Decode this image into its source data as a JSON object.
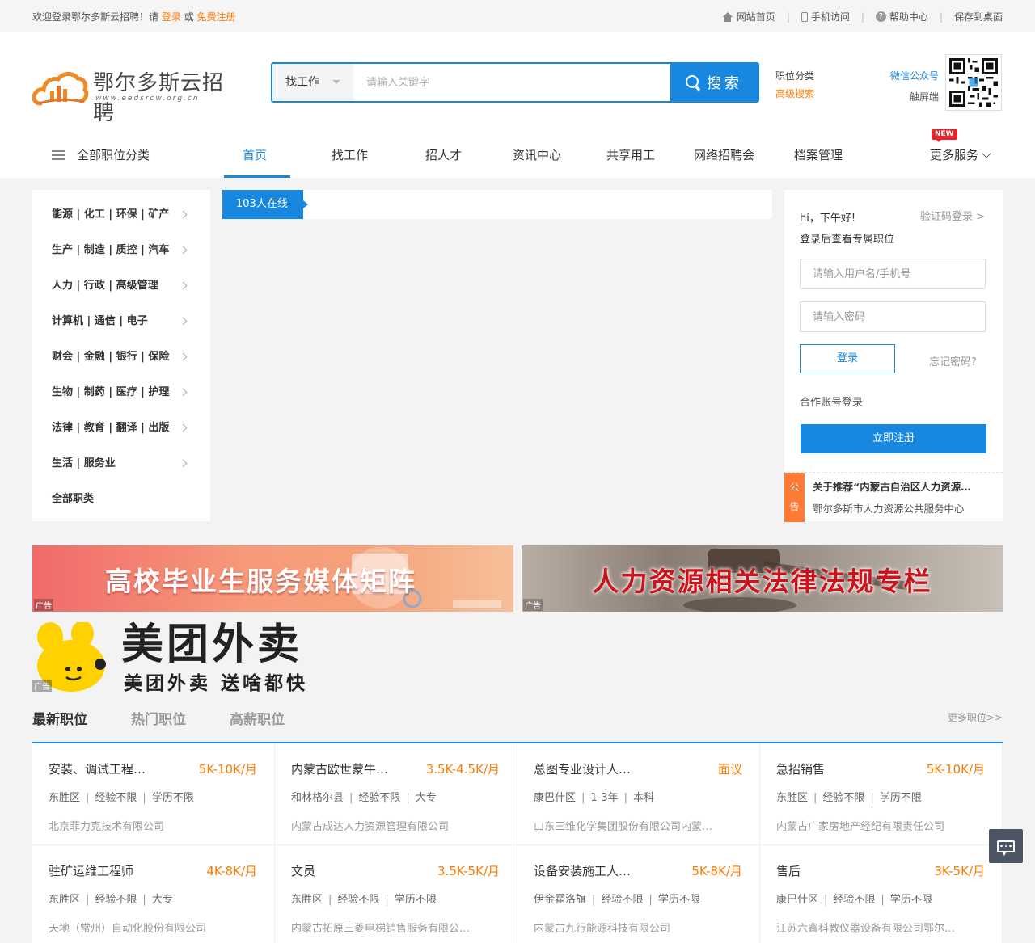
{
  "topbar": {
    "welcome": "欢迎登录鄂尔多斯云招聘！请",
    "login": "登录",
    "or": "或",
    "register": "免费注册",
    "links": [
      {
        "label": "网站首页",
        "icon": "home-icon"
      },
      {
        "label": "手机访问",
        "icon": "phone-icon"
      },
      {
        "label": "帮助中心",
        "icon": "help-icon"
      },
      {
        "label": "保存到桌面",
        "icon": ""
      }
    ],
    "separator": "|"
  },
  "header": {
    "logo_title": "鄂尔多斯云招聘",
    "logo_url": "www.eedsrcw.org.cn",
    "search_type": "找工作",
    "search_placeholder": "请输入关键字",
    "search_button": "搜索",
    "link_category": "职位分类",
    "link_advanced": "高级搜索",
    "wechat": "微信公众号",
    "touch": "触屏端"
  },
  "nav": {
    "all_categories": "全部职位分类",
    "items": [
      "首页",
      "找工作",
      "招人才",
      "资讯中心",
      "共享用工",
      "网络招聘会",
      "档案管理"
    ],
    "more": "更多服务",
    "new_badge": "NEW"
  },
  "categories": [
    "能源 | 化工 | 环保 | 矿产",
    "生产 | 制造 | 质控 | 汽车",
    "人力 | 行政 | 高级管理",
    "计算机 | 通信 | 电子",
    "财会 | 金融 | 银行 | 保险",
    "生物 | 制药 | 医疗 | 护理",
    "法律 | 教育 | 翻译 | 出版",
    "生活 | 服务业",
    "全部职类"
  ],
  "online": "103人在线",
  "login": {
    "greeting": "hi，下午好!",
    "code_login": "验证码登录 >",
    "subtitle": "登录后查看专属职位",
    "username_placeholder": "请输入用户名/手机号",
    "password_placeholder": "请输入密码",
    "login_button": "登录",
    "forgot": "忘记密码?",
    "coop": "合作账号登录",
    "register_button": "立即注册",
    "notice_badge_1": "公",
    "notice_badge_2": "告",
    "notices": [
      "关于推荐“内蒙古自治区人力资源服务行业领军人才”的通知",
      "鄂尔多斯市人力资源公共服务中心"
    ]
  },
  "banners": [
    {
      "text": "高校毕业生服务媒体矩阵",
      "ad": "广告"
    },
    {
      "text": "人力资源相关法律法规专栏",
      "ad": "广告"
    }
  ],
  "meituan": {
    "big": "美团外卖",
    "small": "美团外卖 送啥都快",
    "ad": "广告"
  },
  "job_tabs": {
    "tabs": [
      "最新职位",
      "热门职位",
      "高薪职位"
    ],
    "more": "更多职位>>"
  },
  "jobs": [
    {
      "title": "安装、调试工程…",
      "salary": "5K-10K/月",
      "area": "东胜区",
      "exp": "经验不限",
      "edu": "学历不限",
      "company": "北京菲力克技术有限公司"
    },
    {
      "title": "内蒙古欧世蒙牛…",
      "salary": "3.5K-4.5K/月",
      "area": "和林格尔县",
      "exp": "经验不限",
      "edu": "大专",
      "company": "内蒙古成达人力资源管理有限公司"
    },
    {
      "title": "总图专业设计人…",
      "salary": "面议",
      "area": "康巴什区",
      "exp": "1-3年",
      "edu": "本科",
      "company": "山东三维化学集团股份有限公司内蒙…"
    },
    {
      "title": "急招销售",
      "salary": "5K-10K/月",
      "area": "东胜区",
      "exp": "经验不限",
      "edu": "学历不限",
      "company": "内蒙古广家房地产经纪有限责任公司"
    },
    {
      "title": "驻矿运维工程师",
      "salary": "4K-8K/月",
      "area": "东胜区",
      "exp": "经验不限",
      "edu": "大专",
      "company": "天地（常州）自动化股份有限公司"
    },
    {
      "title": "文员",
      "salary": "3.5K-5K/月",
      "area": "东胜区",
      "exp": "经验不限",
      "edu": "学历不限",
      "company": "内蒙古拓原三菱电梯销售服务有限公…"
    },
    {
      "title": "设备安装施工人…",
      "salary": "5K-8K/月",
      "area": "伊金霍洛旗",
      "exp": "经验不限",
      "edu": "学历不限",
      "company": "内蒙古九行能源科技有限公司"
    },
    {
      "title": "售后",
      "salary": "3K-5K/月",
      "area": "康巴什区",
      "exp": "经验不限",
      "edu": "学历不限",
      "company": "江苏六鑫科教仪器设备有限公司鄂尔…"
    }
  ],
  "colors": {
    "primary": "#1787e0",
    "accent": "#ff7a00",
    "notice": "#ff7a33"
  }
}
